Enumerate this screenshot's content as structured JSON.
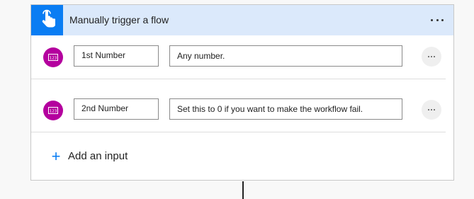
{
  "trigger": {
    "title": "Manually trigger a flow",
    "icon": "touch-hand-icon",
    "tile_color": "#0a7df3",
    "header_color": "#dbe9fb"
  },
  "inputs": [
    {
      "type_icon": "number-icon",
      "icon_color": "#b4009e",
      "name": "1st Number",
      "description": "Any number."
    },
    {
      "type_icon": "number-icon",
      "icon_color": "#b4009e",
      "name": "2nd Number",
      "description": "Set this to 0 if you want to make the workflow fail."
    }
  ],
  "add_input": {
    "label": "Add an input",
    "icon": "plus-icon"
  }
}
